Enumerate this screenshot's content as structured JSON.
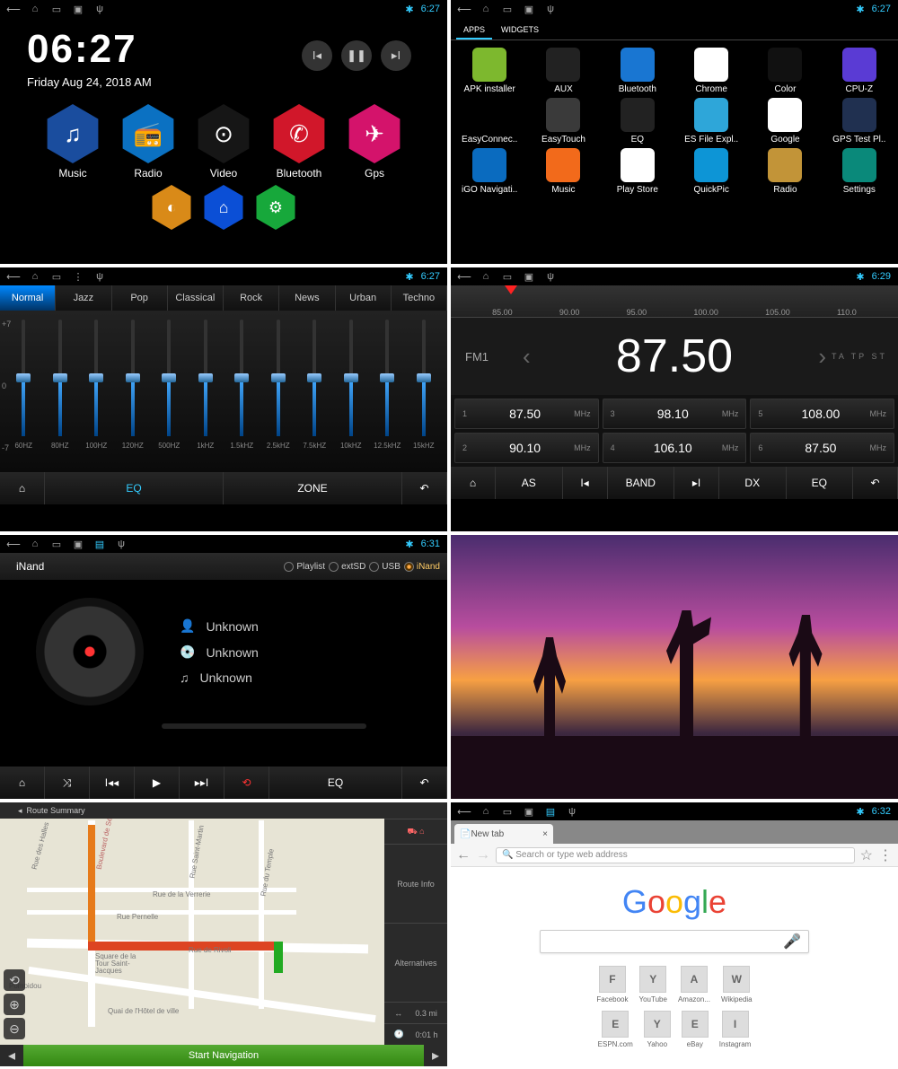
{
  "status": {
    "time1": "6:27",
    "time2": "6:27",
    "time3": "6:27",
    "time4": "6:29",
    "time5": "6:31",
    "time8": "6:32"
  },
  "home": {
    "time": "06:27",
    "date": "Friday Aug 24, 2018 AM",
    "hex": [
      {
        "label": "Music",
        "color": "#1a4d9e"
      },
      {
        "label": "Radio",
        "color": "#0b71c2"
      },
      {
        "label": "Video",
        "color": "#161616"
      },
      {
        "label": "Bluetooth",
        "color": "#d1172a"
      },
      {
        "label": "Gps",
        "color": "#d4136b"
      }
    ],
    "hex2": [
      {
        "color": "#d98a18"
      },
      {
        "color": "#0b4fd6"
      },
      {
        "color": "#17a83b"
      }
    ]
  },
  "drawer": {
    "tabs": [
      "APPS",
      "WIDGETS"
    ],
    "apps": [
      {
        "label": "APK installer",
        "bg": "#7db82e"
      },
      {
        "label": "AUX",
        "bg": "#222"
      },
      {
        "label": "Bluetooth",
        "bg": "#1976d2"
      },
      {
        "label": "Chrome",
        "bg": "#fff"
      },
      {
        "label": "Color",
        "bg": "#111"
      },
      {
        "label": "CPU-Z",
        "bg": "#5a3bd4"
      },
      {
        "label": "EasyConnec..",
        "bg": "#000"
      },
      {
        "label": "EasyTouch",
        "bg": "#3a3a3a"
      },
      {
        "label": "EQ",
        "bg": "#222"
      },
      {
        "label": "ES File Expl..",
        "bg": "#2ea6d9"
      },
      {
        "label": "Google",
        "bg": "#fff"
      },
      {
        "label": "GPS Test Pl..",
        "bg": "#203050"
      },
      {
        "label": "iGO Navigati..",
        "bg": "#0a6bbf"
      },
      {
        "label": "Music",
        "bg": "#f26a1b"
      },
      {
        "label": "Play Store",
        "bg": "#fff"
      },
      {
        "label": "QuickPic",
        "bg": "#0d95d6"
      },
      {
        "label": "Radio",
        "bg": "#c29438"
      },
      {
        "label": "Settings",
        "bg": "#0a897a"
      }
    ]
  },
  "eq": {
    "presets": [
      "Normal",
      "Jazz",
      "Pop",
      "Classical",
      "Rock",
      "News",
      "Urban",
      "Techno"
    ],
    "active": "Normal",
    "scale": [
      "+7",
      "0",
      "-7"
    ],
    "bands": [
      {
        "hz": "60HZ",
        "v": 50
      },
      {
        "hz": "80HZ",
        "v": 50
      },
      {
        "hz": "100HZ",
        "v": 50
      },
      {
        "hz": "120HZ",
        "v": 50
      },
      {
        "hz": "500HZ",
        "v": 50
      },
      {
        "hz": "1kHZ",
        "v": 50
      },
      {
        "hz": "1.5kHZ",
        "v": 50
      },
      {
        "hz": "2.5kHZ",
        "v": 50
      },
      {
        "hz": "7.5kHZ",
        "v": 50
      },
      {
        "hz": "10kHZ",
        "v": 50
      },
      {
        "hz": "12.5kHZ",
        "v": 50
      },
      {
        "hz": "15kHZ",
        "v": 50
      }
    ],
    "bottom": {
      "eq": "EQ",
      "zone": "ZONE"
    }
  },
  "radio": {
    "ticks": [
      "85.00",
      "90.00",
      "95.00",
      "100.00",
      "105.00",
      "110.0"
    ],
    "band": "FM1",
    "freq": "87.50",
    "indicators": "TA TP ST",
    "presets": [
      {
        "n": "1",
        "f": "87.50",
        "u": "MHz"
      },
      {
        "n": "3",
        "f": "98.10",
        "u": "MHz"
      },
      {
        "n": "5",
        "f": "108.00",
        "u": "MHz"
      },
      {
        "n": "2",
        "f": "90.10",
        "u": "MHz"
      },
      {
        "n": "4",
        "f": "106.10",
        "u": "MHz"
      },
      {
        "n": "6",
        "f": "87.50",
        "u": "MHz"
      }
    ],
    "bottom": [
      "AS",
      "BAND",
      "DX",
      "EQ"
    ]
  },
  "player": {
    "source": "iNand",
    "opts": [
      {
        "l": "Playlist",
        "on": false
      },
      {
        "l": "extSD",
        "on": false
      },
      {
        "l": "USB",
        "on": false
      },
      {
        "l": "iNand",
        "on": true
      }
    ],
    "artist": "Unknown",
    "album": "Unknown",
    "track": "Unknown",
    "bottom": {
      "eq": "EQ"
    }
  },
  "map": {
    "title": "Route Summary",
    "side": [
      "",
      "Route Info",
      "Alternatives"
    ],
    "dist": "0.3 mi",
    "time": "0:01 h",
    "start": "Start Navigation",
    "streets": [
      "Boulevard de Sébastopol",
      "Rue de Rivoli",
      "Rue Pernelle",
      "Rue de la Verrerie",
      "Rue du Temple",
      "Rue Saint-Martin",
      "Rue des Halles",
      "Quai de l'Hôtel de ville",
      "Square de la Tour Saint-Jacques",
      "Pompidou"
    ]
  },
  "browser": {
    "tab": "New tab",
    "placeholder": "Search or type web address",
    "logo": [
      {
        "c": "#4285F4",
        "t": "G"
      },
      {
        "c": "#EA4335",
        "t": "o"
      },
      {
        "c": "#FBBC05",
        "t": "o"
      },
      {
        "c": "#4285F4",
        "t": "g"
      },
      {
        "c": "#34A853",
        "t": "l"
      },
      {
        "c": "#EA4335",
        "t": "e"
      }
    ],
    "row1": [
      {
        "i": "F",
        "l": "Facebook"
      },
      {
        "i": "Y",
        "l": "YouTube"
      },
      {
        "i": "A",
        "l": "Amazon..."
      },
      {
        "i": "W",
        "l": "Wikipedia"
      }
    ],
    "row2": [
      {
        "i": "E",
        "l": "ESPN.com"
      },
      {
        "i": "Y",
        "l": "Yahoo"
      },
      {
        "i": "E",
        "l": "eBay"
      },
      {
        "i": "I",
        "l": "Instagram"
      }
    ]
  }
}
